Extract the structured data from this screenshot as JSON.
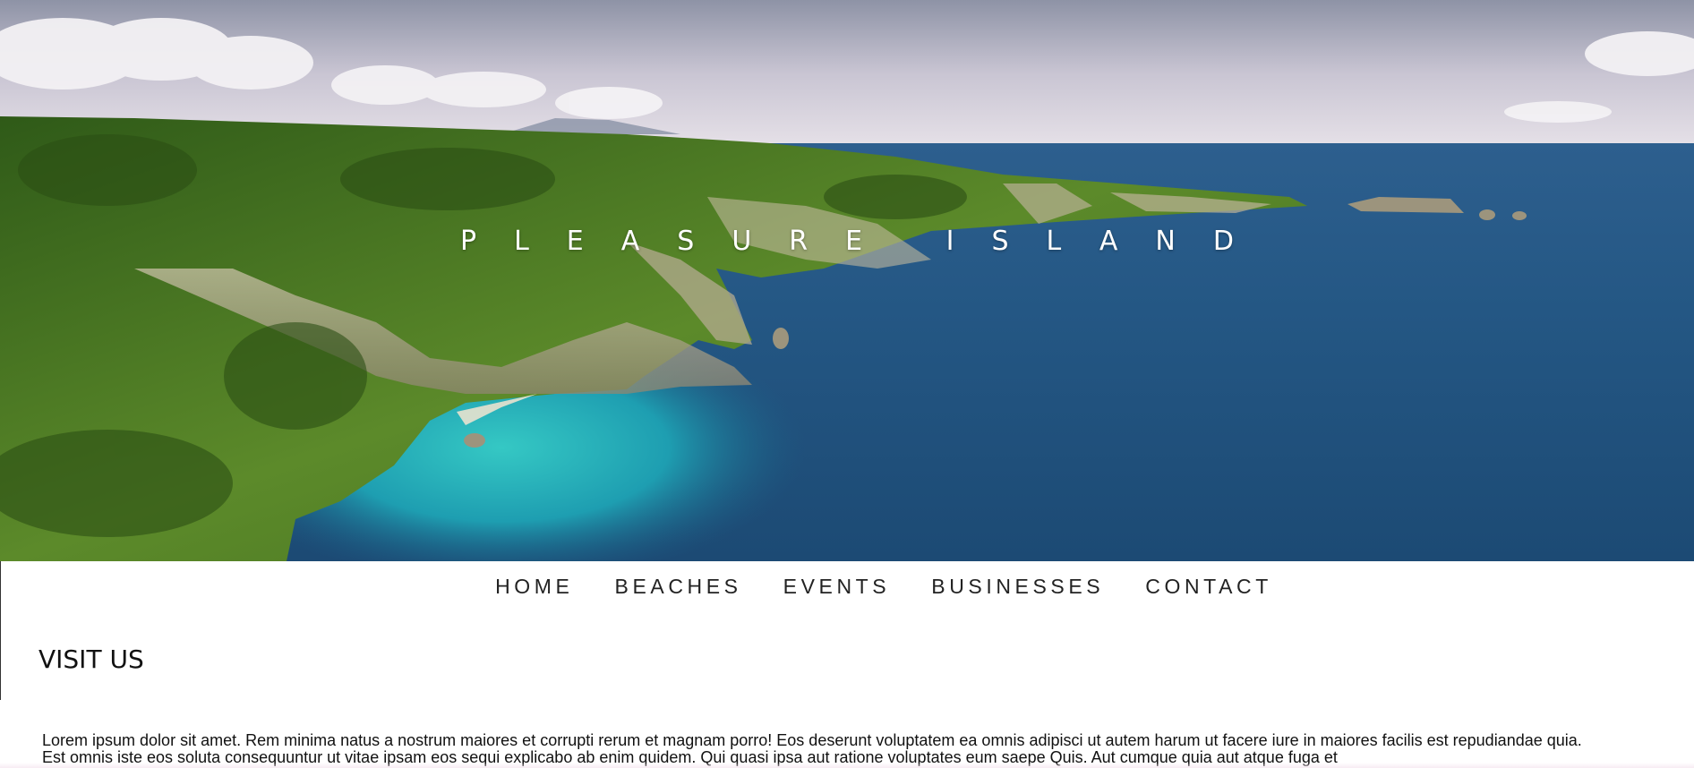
{
  "hero": {
    "title": "PLEASURE ISLAND"
  },
  "nav": {
    "items": [
      {
        "label": "HOME"
      },
      {
        "label": "BEACHES"
      },
      {
        "label": "EVENTS"
      },
      {
        "label": "BUSINESSES"
      },
      {
        "label": "CONTACT"
      }
    ]
  },
  "section": {
    "title": "VISIT US",
    "body": "Lorem ipsum dolor sit amet. Rem minima natus a nostrum maiores et corrupti rerum et magnam porro! Eos deserunt voluptatem ea omnis adipisci ut autem harum ut facere iure in maiores facilis est repudiandae quia. Est omnis iste eos soluta consequuntur ut vitae ipsam eos sequi explicabo ab enim quidem. Qui quasi ipsa aut ratione voluptates eum saepe Quis. Aut cumque quia aut atque fuga et"
  },
  "colors": {
    "sky_top": "#8e96a8",
    "sea_deep": "#1f4f7a",
    "lagoon": "#1aa8b0",
    "forest": "#3d6a1e"
  }
}
